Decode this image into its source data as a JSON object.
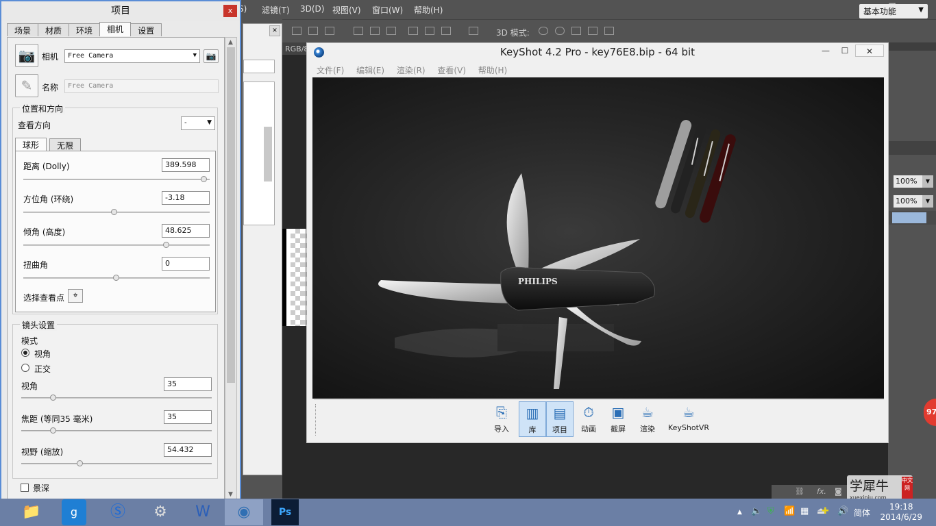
{
  "photoshop": {
    "menu": [
      "S)",
      "滤镜(T)",
      "3D(D)",
      "视图(V)",
      "窗口(W)",
      "帮助(H)"
    ],
    "mode_3d_label": "3D 模式:",
    "workspace": "基本功能",
    "doc_tab": "RGB/8",
    "zoom_values": [
      "100%",
      "100%"
    ],
    "badge": "97"
  },
  "project_panel": {
    "title": "项目",
    "close": "x",
    "tabs": [
      "场景",
      "材质",
      "环境",
      "相机",
      "设置"
    ],
    "active_tab": "相机",
    "camera_label": "相机",
    "camera_value": "Free Camera",
    "name_label": "名称",
    "name_value": "Free Camera",
    "position_group": "位置和方向",
    "look_direction_label": "查看方向",
    "look_direction_value": "-",
    "sub_tabs": [
      "球形",
      "无限"
    ],
    "distance_label": "距离 (Dolly)",
    "distance_value": "389.598",
    "distance_level": 0.97,
    "azimuth_label": "方位角 (环绕)",
    "azimuth_value": "-3.18",
    "azimuth_level": 0.49,
    "inclination_label": "倾角 (高度)",
    "inclination_value": "48.625",
    "inclination_level": 0.77,
    "twist_label": "扭曲角",
    "twist_value": "0",
    "twist_level": 0.5,
    "pick_look_at_label": "选择查看点",
    "lens_group": "镜头设置",
    "mode_label": "模式",
    "mode_perspective": "视角",
    "mode_orthographic": "正交",
    "fov_label": "视角",
    "fov_value": "35",
    "fov_level": 0.17,
    "focal_label": "焦距 (等同35 毫米)",
    "focal_value": "35",
    "focal_level": 0.17,
    "zoom_label": "视野 (缩放)",
    "zoom_value": "54.432",
    "zoom_level": 0.31,
    "dof_label": "景深"
  },
  "keyshot": {
    "title": "KeyShot 4.2 Pro  - key76E8.bip  - 64 bit",
    "menu": [
      "文件(F)",
      "编辑(E)",
      "渲染(R)",
      "查看(V)",
      "帮助(H)"
    ],
    "knife_brand": "PHILIPS",
    "toolbar": [
      "导入",
      "库",
      "项目",
      "动画",
      "截屏",
      "渲染",
      "KeyShotVR"
    ],
    "icons": [
      "import-icon",
      "library-icon",
      "project-icon",
      "animation-icon",
      "screenshot-icon",
      "render-icon",
      "keyshotvr-icon"
    ]
  },
  "taskbar": {
    "ime": "简体",
    "time": "19:18",
    "date": "2014/6/29"
  },
  "watermark": {
    "text": "学犀牛",
    "url": "xuexiniu.com",
    "badge": "中文网"
  }
}
